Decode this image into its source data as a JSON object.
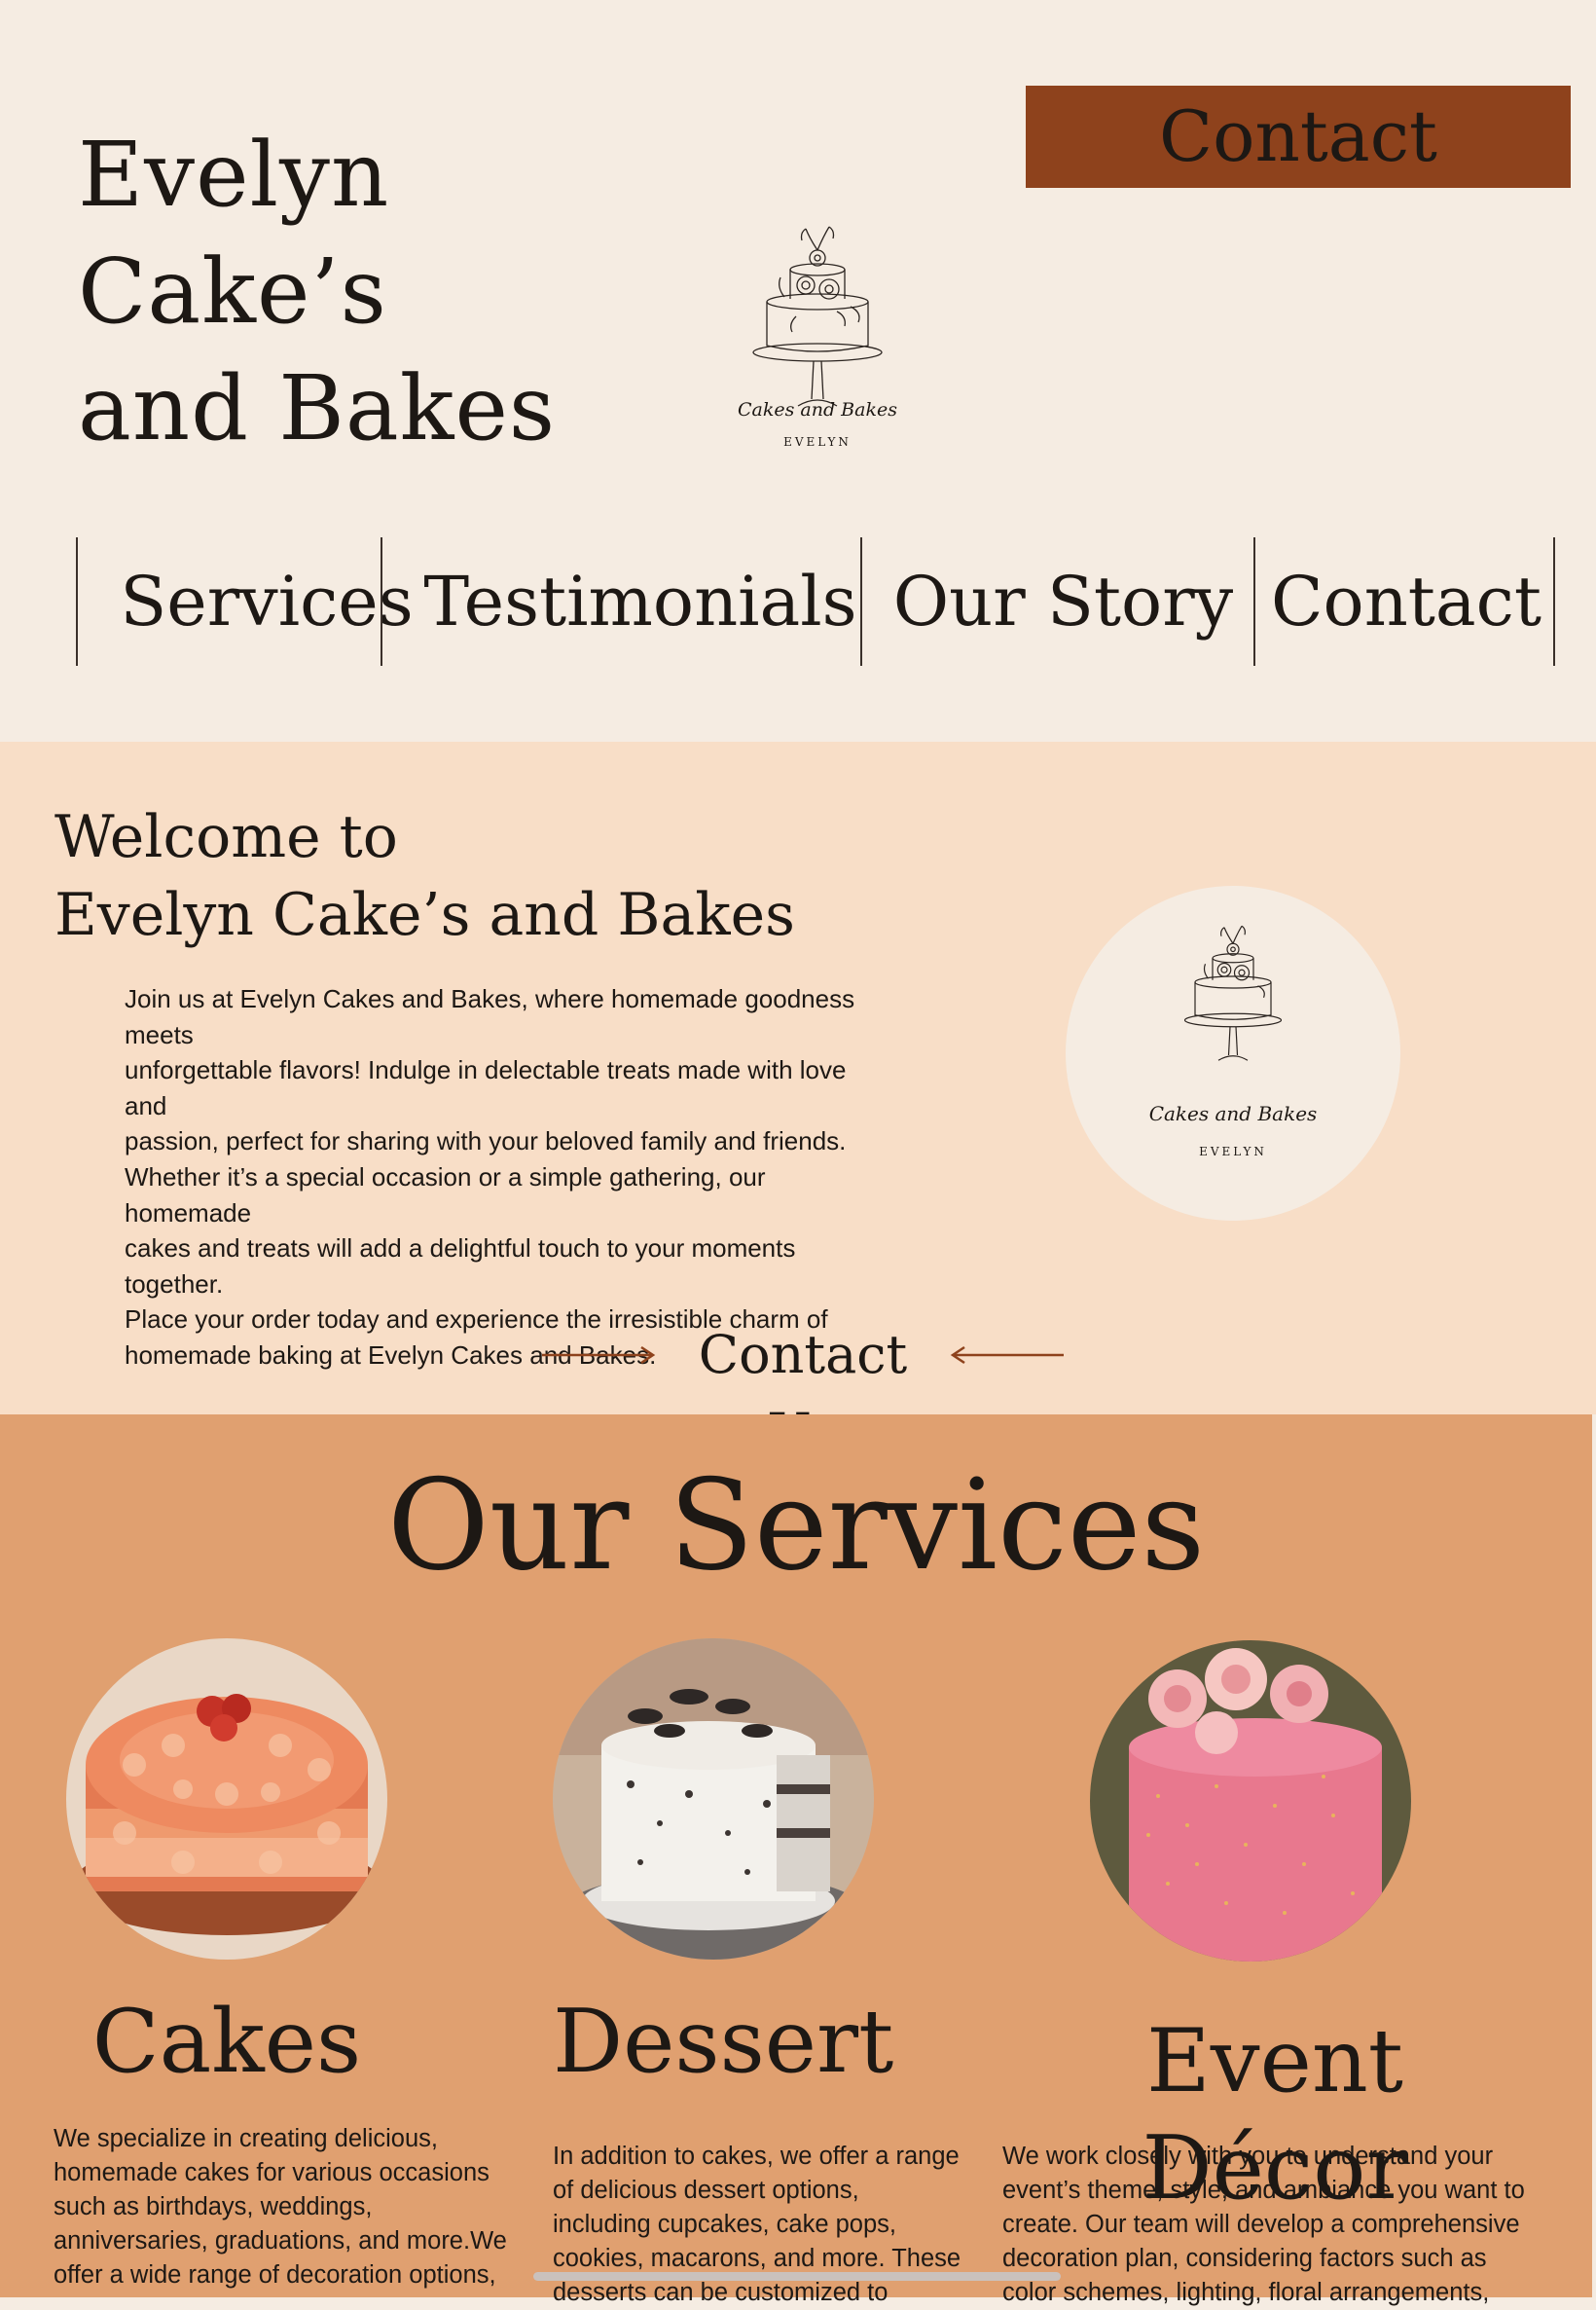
{
  "header": {
    "title_line1": "Evelyn Cake’s",
    "title_line2": "and Bakes",
    "contact_button": "Contact",
    "logo": {
      "script_text": "Cakes and Bakes",
      "name": "EVELYN",
      "icon": "cake-illustration-icon"
    }
  },
  "nav": {
    "items": [
      "Services",
      "Testimonials",
      "Our Story",
      "Contact"
    ]
  },
  "welcome": {
    "title_line1": "Welcome to",
    "title_line2": "Evelyn Cake’s and Bakes",
    "body_lines": [
      "Join us at Evelyn Cakes and Bakes, where homemade goodness meets",
      "unforgettable flavors! Indulge in delectable treats made with love and",
      "passion, perfect for sharing with your beloved family and friends.",
      "Whether it’s a special occasion or a simple gathering, our homemade",
      "cakes and treats will add a delightful touch to your moments together.",
      "Place your order today and experience the irresistible charm of",
      "homemade baking at Evelyn Cakes and Bakes."
    ],
    "logo": {
      "script_text": "Cakes and Bakes",
      "name": "EVELYN"
    },
    "contact_us": "Contact Us"
  },
  "services": {
    "title": "Our Services",
    "items": [
      {
        "name": "Cakes",
        "image_icon": "rosette-cake-photo",
        "desc_lines": [
          "We specialize in creating delicious,",
          "homemade cakes for various occasions",
          "such as birthdays, weddings,",
          "anniversaries, graduations, and more.We",
          "offer a wide range of decoration options,"
        ]
      },
      {
        "name": "Dessert",
        "image_icon": "cookies-cream-cake-photo",
        "desc_lines": [
          "In addition to cakes, we offer a range",
          "of delicious dessert options,",
          "including cupcakes, cake pops,",
          "cookies, macarons, and more. These",
          "desserts can be customized to"
        ]
      },
      {
        "name": "Event Décor",
        "image_icon": "pink-rose-cake-photo",
        "desc_lines": [
          "We work closely with you to understand your",
          "event’s theme, style, and ambiance you want to",
          "create. Our team will develop a comprehensive",
          "decoration plan, considering factors such as",
          "color schemes, lighting, floral arrangements,"
        ]
      }
    ]
  },
  "colors": {
    "header_bg": "#f5ece2",
    "welcome_bg": "#f8dec7",
    "services_bg": "#e0a070",
    "accent": "#8e421c",
    "text": "#1d1814"
  }
}
